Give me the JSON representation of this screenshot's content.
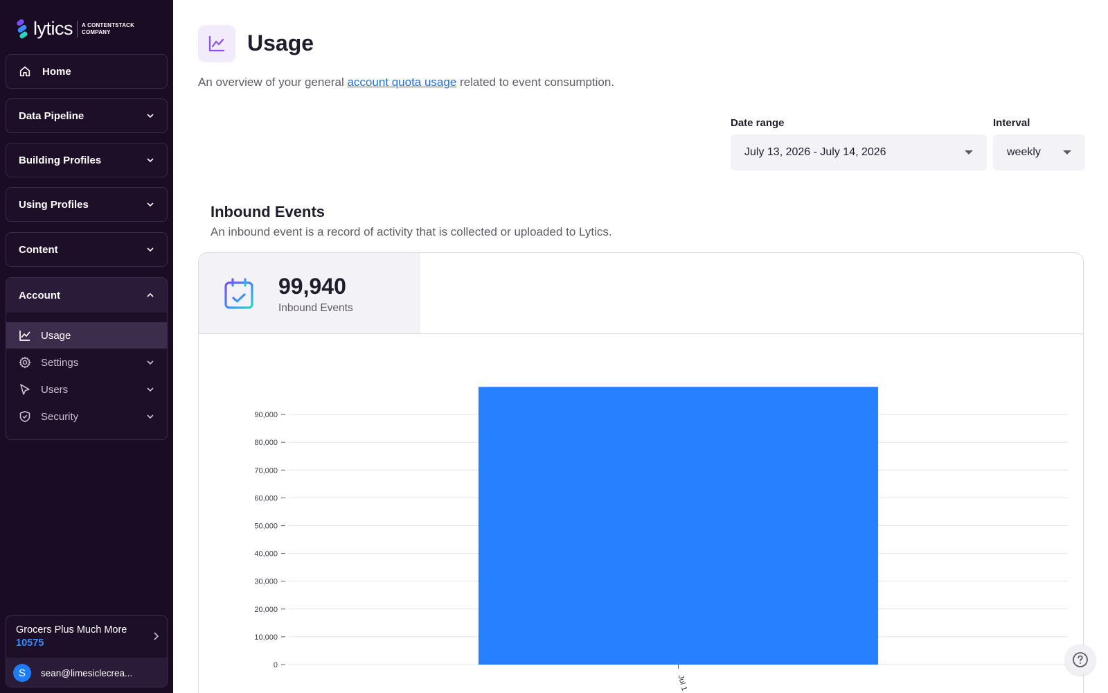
{
  "brand": {
    "name": "lytics",
    "tagline_line1": "A CONTENTSTACK",
    "tagline_line2": "COMPANY"
  },
  "sidebar": {
    "home": "Home",
    "sections": [
      {
        "label": "Data Pipeline"
      },
      {
        "label": "Building Profiles"
      },
      {
        "label": "Using Profiles"
      },
      {
        "label": "Content"
      }
    ],
    "account": {
      "label": "Account",
      "items": [
        {
          "label": "Usage",
          "icon": "line-chart-icon",
          "active": true
        },
        {
          "label": "Settings",
          "icon": "gear-icon"
        },
        {
          "label": "Users",
          "icon": "cursor-icon"
        },
        {
          "label": "Security",
          "icon": "shield-icon"
        }
      ]
    },
    "org": {
      "name": "Grocers Plus Much More",
      "id": "10575"
    },
    "user": {
      "initial": "S",
      "email": "sean@limesiclecrea..."
    }
  },
  "page": {
    "title": "Usage",
    "desc_before": "An overview of your general ",
    "desc_link": "account quota usage",
    "desc_after": " related to event consumption."
  },
  "filters": {
    "date_range_label": "Date range",
    "date_range_value": "July 13, 2026 - July 14, 2026",
    "interval_label": "Interval",
    "interval_value": "weekly"
  },
  "inbound": {
    "title": "Inbound Events",
    "desc": "An inbound event is a record of activity that is collected or uploaded to Lytics.",
    "metric_value": "99,940",
    "metric_label": "Inbound Events"
  },
  "colors": {
    "accent": "#2680ff",
    "sidebar_bg": "#1a0c24",
    "link": "#1f6fe5"
  },
  "chart_data": {
    "type": "bar",
    "categories": [
      "Jul 1"
    ],
    "values": [
      99940
    ],
    "ylim": [
      0,
      100000
    ],
    "yticks": [
      0,
      10000,
      20000,
      30000,
      40000,
      50000,
      60000,
      70000,
      80000,
      90000
    ],
    "ytick_labels": [
      "0",
      "10,000",
      "20,000",
      "30,000",
      "40,000",
      "50,000",
      "60,000",
      "70,000",
      "80,000",
      "90,000"
    ],
    "grid": true,
    "color": "#2680ff"
  }
}
